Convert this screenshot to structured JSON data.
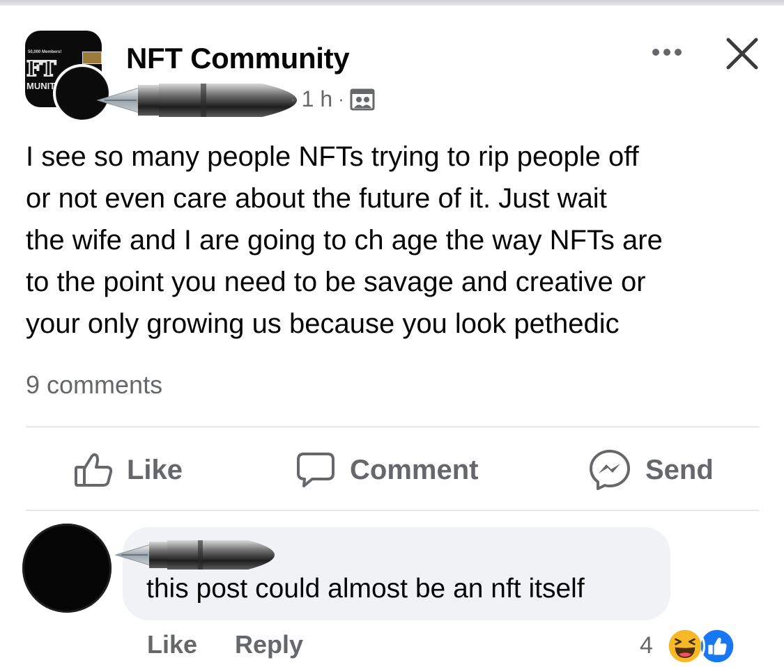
{
  "post": {
    "group_name": "NFT Community",
    "group_avatar": {
      "members_text": "50,000 Members!",
      "big_text": "FT",
      "small_text": "MUNITY"
    },
    "time": "1 h",
    "separator": "·",
    "audience_icon": "group-audience-icon",
    "more_icon": "more-dots-icon",
    "close_icon": "close-icon",
    "text_lines": [
      "I see so many people NFTs trying to rip people off",
      "or not even care about the future of it.  Just wait",
      "the wife and I are going to ch age the way NFTs are",
      "to the point you need to be savage and creative or",
      "your only growing us because you look pethedic"
    ],
    "comments_count": "9 comments"
  },
  "actions": {
    "like": "Like",
    "comment": "Comment",
    "send": "Send"
  },
  "comment": {
    "text": "this post could almost be an nft itself",
    "like": "Like",
    "reply": "Reply",
    "reaction_count": "4",
    "reactions": [
      "haha-icon",
      "like-icon"
    ]
  },
  "colors": {
    "text": "#050505",
    "secondary": "#65676b",
    "bubble": "#f0f2f5",
    "like_blue": "#1877f2",
    "haha_yellow": "#f7b928"
  }
}
